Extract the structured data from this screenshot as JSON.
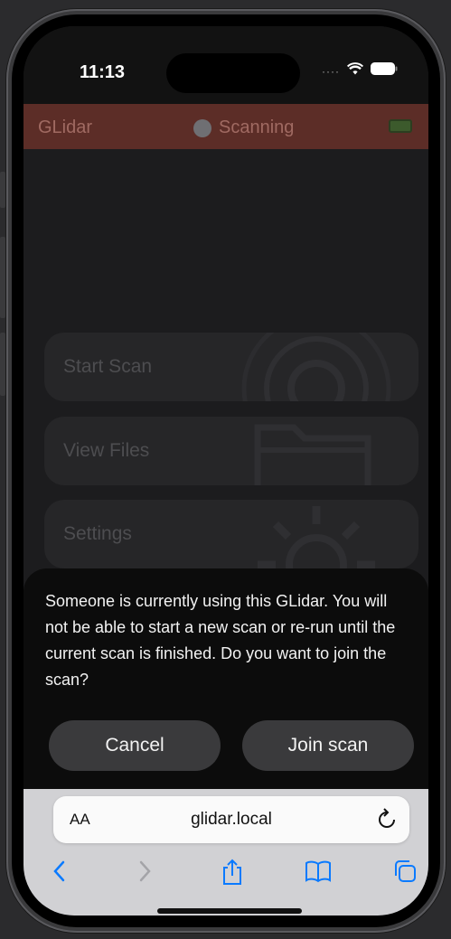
{
  "status_bar": {
    "time": "11:13",
    "signal_dots": "····"
  },
  "app_header": {
    "title": "GLidar",
    "scan_status": "Scanning"
  },
  "menu": {
    "start_scan": "Start Scan",
    "view_files": "View Files",
    "settings": "Settings"
  },
  "dialog": {
    "message": "Someone is currently using this GLidar. You will not be able to start a new scan or re-run until the current scan is finished. Do you want to join the scan?",
    "cancel_label": "Cancel",
    "join_label": "Join scan"
  },
  "browser": {
    "text_size_label": "AA",
    "url": "glidar.local"
  },
  "colors": {
    "header_bg": "#5c2d27",
    "accent_blue": "#0a7aff",
    "battery_green": "#3c5a2c"
  }
}
